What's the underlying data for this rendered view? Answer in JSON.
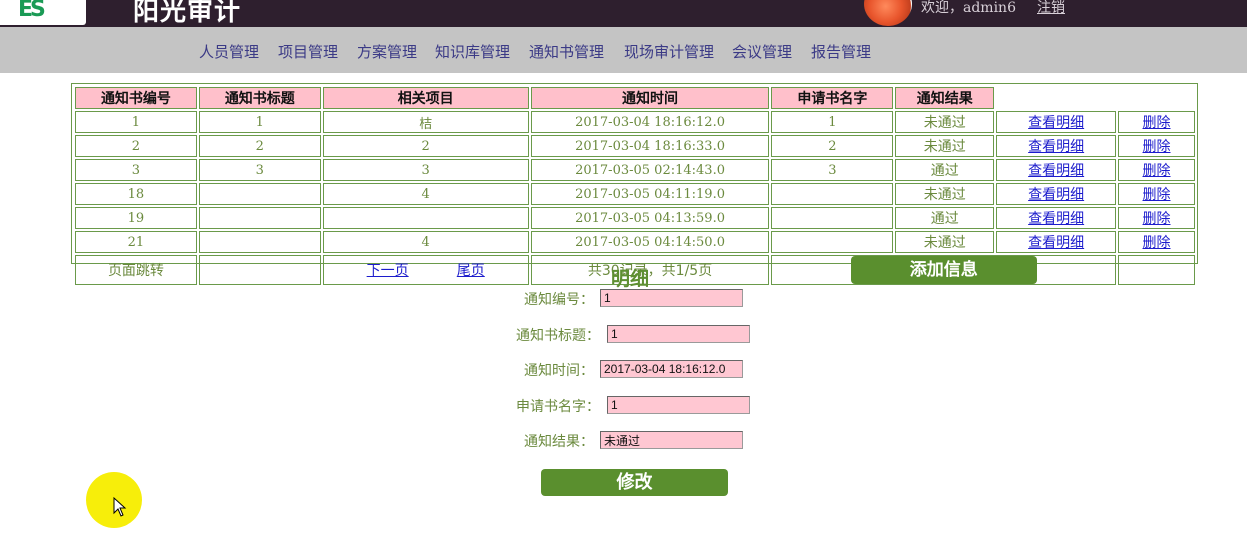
{
  "header": {
    "logo_text": "ES",
    "app_title": "阳光审计",
    "welcome_text": "欢迎，admin6",
    "logout_label": "注销"
  },
  "nav": {
    "items": [
      {
        "label": "人员管理"
      },
      {
        "label": "项目管理"
      },
      {
        "label": "方案管理"
      },
      {
        "label": "知识库管理"
      },
      {
        "label": "通知书管理"
      },
      {
        "label": "现场审计管理"
      },
      {
        "label": "会议管理"
      },
      {
        "label": "报告管理"
      }
    ]
  },
  "table": {
    "columns": [
      "通知书编号",
      "通知书标题",
      "相关项目",
      "通知时间",
      "申请书名字",
      "通知结果"
    ],
    "view_label": "查看明细",
    "delete_label": "删除",
    "rows": [
      {
        "id": "1",
        "title": "1",
        "project": "桔",
        "time": "2017-03-04 18:16:12.0",
        "applicant": "1",
        "result": "未通过"
      },
      {
        "id": "2",
        "title": "2",
        "project": "2",
        "time": "2017-03-04 18:16:33.0",
        "applicant": "2",
        "result": "未通过"
      },
      {
        "id": "3",
        "title": "3",
        "project": "3",
        "time": "2017-03-05 02:14:43.0",
        "applicant": "3",
        "result": "通过"
      },
      {
        "id": "18",
        "title": "",
        "project": "4",
        "time": "2017-03-05 04:11:19.0",
        "applicant": "",
        "result": "未通过"
      },
      {
        "id": "19",
        "title": "",
        "project": "",
        "time": "2017-03-05 04:13:59.0",
        "applicant": "",
        "result": "通过"
      },
      {
        "id": "21",
        "title": "",
        "project": "4",
        "time": "2017-03-05 04:14:50.0",
        "applicant": "",
        "result": "未通过"
      }
    ],
    "footer": {
      "jump_label": "页面跳转",
      "next_label": "下一页",
      "last_label": "尾页",
      "summary": "共30记录，共1/5页",
      "add_label": "添加信息"
    }
  },
  "detail": {
    "title": "明细",
    "fields": {
      "notice_id": {
        "label": "通知编号：",
        "value": "1"
      },
      "notice_title": {
        "label": "通知书标题：",
        "value": "1"
      },
      "notice_time": {
        "label": "通知时间：",
        "value": "2017-03-04 18:16:12.0"
      },
      "applicant": {
        "label": "申请书名字：",
        "value": "1"
      },
      "result": {
        "label": "通知结果：",
        "value": "未通过"
      }
    },
    "modify_label": "修改"
  },
  "colors": {
    "header_bg": "#2e1f2e",
    "nav_bg": "#c4c4c4",
    "nav_text": "#3b3a86",
    "header_cell_bg": "#ffc0cb",
    "cell_text": "#6b8a3e",
    "grid_border": "#6a9a4a",
    "button_bg": "#5a8f2e",
    "link": "#1c1ccc",
    "cursor_halo": "#f7ee0a"
  }
}
